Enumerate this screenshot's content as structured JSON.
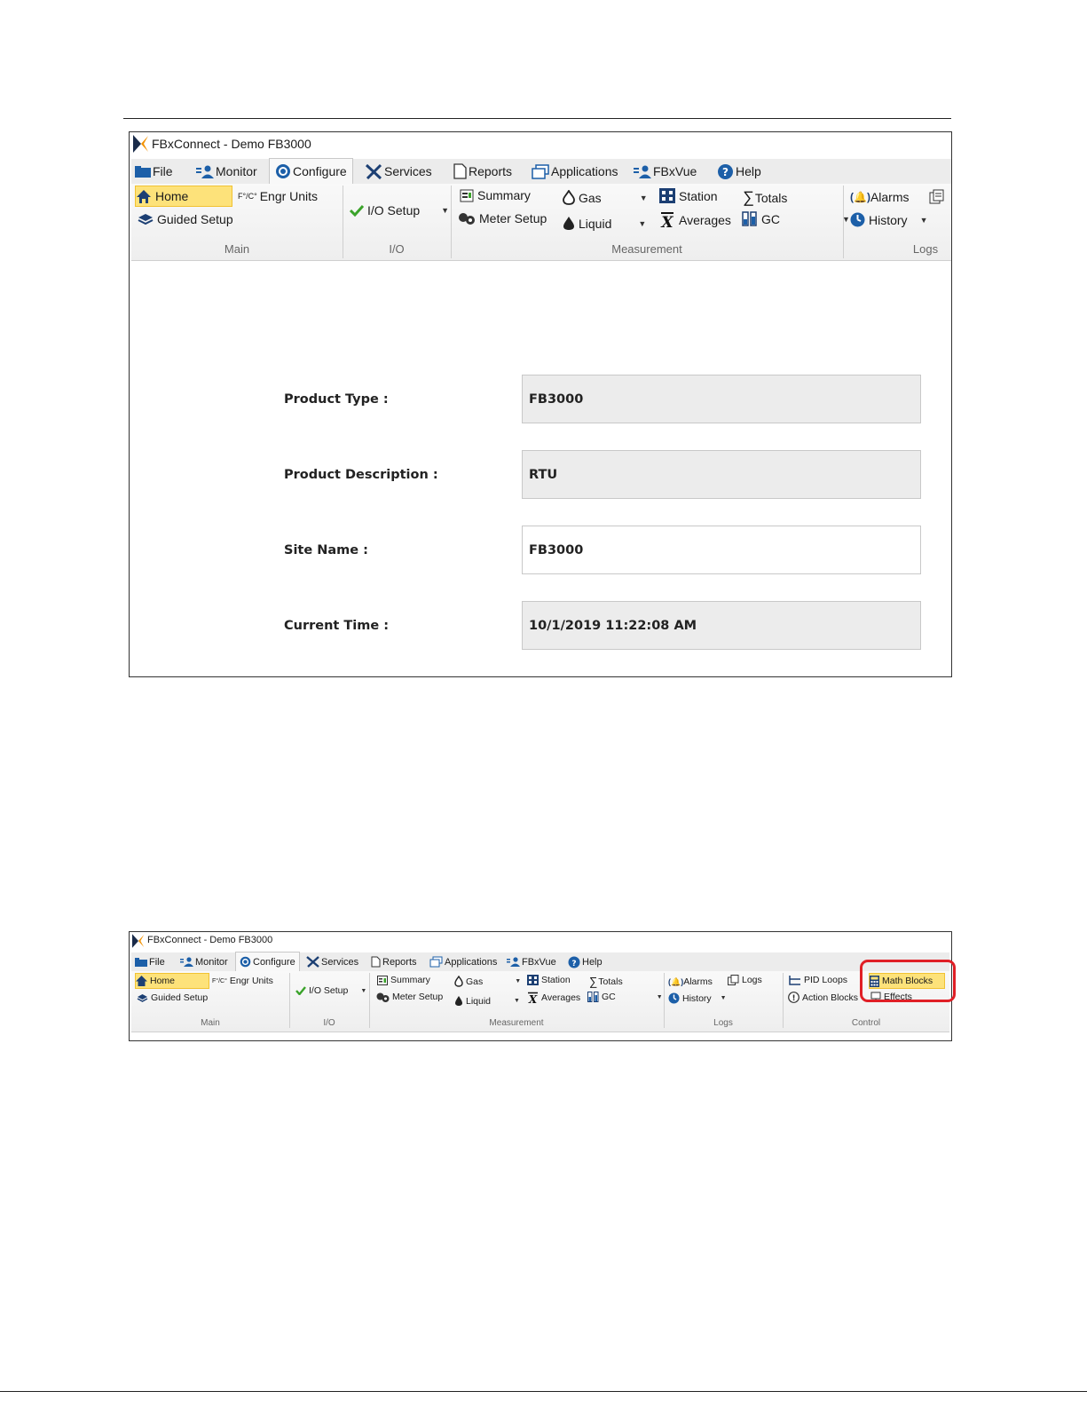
{
  "app": {
    "title": "FBxConnect - Demo FB3000"
  },
  "tabs": [
    {
      "label": "File",
      "icon": "folder-icon"
    },
    {
      "label": "Monitor",
      "icon": "monitor-user-icon"
    },
    {
      "label": "Configure",
      "icon": "gear-icon",
      "active": true
    },
    {
      "label": "Services",
      "icon": "tools-icon"
    },
    {
      "label": "Reports",
      "icon": "document-icon"
    },
    {
      "label": "Applications",
      "icon": "windows-icon"
    },
    {
      "label": "FBxVue",
      "icon": "fbxvue-icon"
    },
    {
      "label": "Help",
      "icon": "help-icon"
    }
  ],
  "ribbon": {
    "main": {
      "home": "Home",
      "engr_units_prefix": "F°/C°",
      "engr_units": "Engr Units",
      "guided_setup": "Guided Setup",
      "group": "Main"
    },
    "io": {
      "io_setup": "I/O Setup",
      "group": "I/O"
    },
    "measurement": {
      "summary": "Summary",
      "meter_setup": "Meter Setup",
      "gas": "Gas",
      "liquid": "Liquid",
      "station": "Station",
      "averages": "Averages",
      "totals": "Totals",
      "gc": "GC",
      "group": "Measurement"
    },
    "logs": {
      "alarms": "Alarms",
      "history": "History",
      "logs": "Logs",
      "group": "Logs"
    },
    "control": {
      "pid_loops": "PID Loops",
      "action_blocks": "Action Blocks",
      "math_blocks": "Math Blocks",
      "effects": "Effects",
      "group": "Control"
    }
  },
  "form": {
    "product_type": {
      "label": "Product Type :",
      "value": "FB3000"
    },
    "product_description": {
      "label": "Product Description :",
      "value": "RTU"
    },
    "site_name": {
      "label": "Site Name :",
      "value": "FB3000"
    },
    "current_time": {
      "label": "Current Time :",
      "value": "10/1/2019 11:22:08 AM"
    }
  },
  "colors": {
    "selected_bg": "#fde27a",
    "highlight_outline": "#e01f26",
    "tab_bar_bg": "#ececec",
    "readonly_field_bg": "#ececec"
  }
}
